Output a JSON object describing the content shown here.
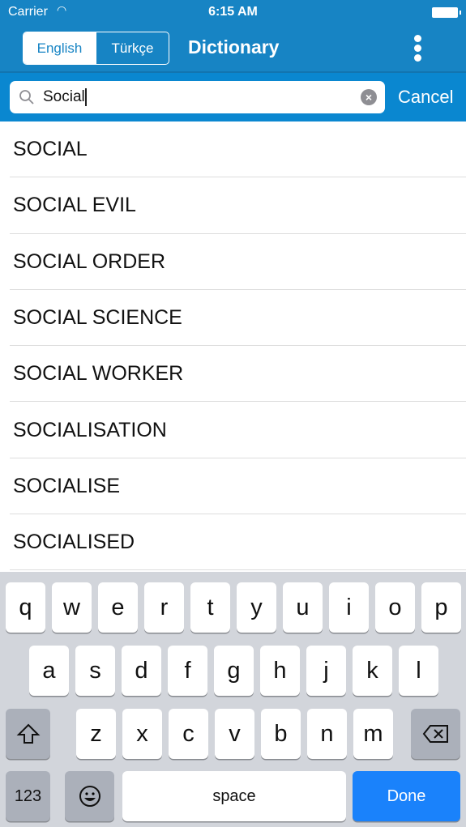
{
  "status": {
    "carrier": "Carrier",
    "time": "6:15 AM"
  },
  "nav": {
    "segments": [
      "English",
      "Türkçe"
    ],
    "selected": "English",
    "title": "Dictionary"
  },
  "search": {
    "value": "Social",
    "cancel": "Cancel"
  },
  "results": [
    "SOCIAL",
    "SOCIAL EVIL",
    "SOCIAL ORDER",
    "SOCIAL SCIENCE",
    "SOCIAL WORKER",
    "SOCIALISATION",
    "SOCIALISE",
    "SOCIALISED"
  ],
  "keyboard": {
    "row1": [
      "q",
      "w",
      "e",
      "r",
      "t",
      "y",
      "u",
      "i",
      "o",
      "p"
    ],
    "row2": [
      "a",
      "s",
      "d",
      "f",
      "g",
      "h",
      "j",
      "k",
      "l"
    ],
    "row3": [
      "z",
      "x",
      "c",
      "v",
      "b",
      "n",
      "m"
    ],
    "numbers": "123",
    "space": "space",
    "done": "Done"
  },
  "colors": {
    "nav": "#1784c4",
    "search_bar": "#0a87d0",
    "done": "#1a82fb"
  }
}
